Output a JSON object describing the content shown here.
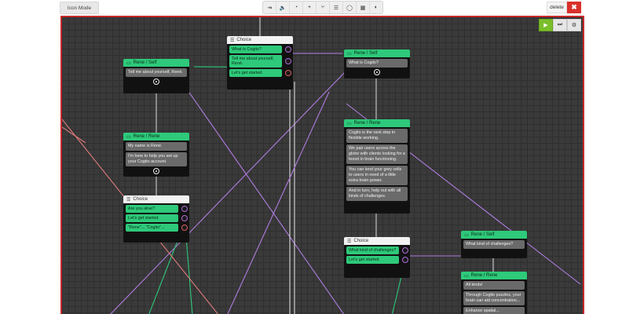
{
  "toolbar": {
    "mode_label": "Icon Mode",
    "tools": [
      "sign-in-icon",
      "volume-icon",
      "clock-icon",
      "plus-icon",
      "branch-icon",
      "list-icon",
      "comment-icon",
      "calendar-icon",
      "palette-icon"
    ],
    "tool_glyphs": [
      "⇥",
      "🔈",
      "◔",
      "+",
      "⑂",
      "☰",
      "◯",
      "▦",
      "◐"
    ],
    "delete_label": "delete",
    "close_glyph": "✖"
  },
  "controls": {
    "play": "▶",
    "skip": "⏭",
    "settings": "⚙"
  },
  "nodes": {
    "n1": {
      "header": "Rene / Self",
      "bubbles": [
        "Tell me about yourself, René."
      ]
    },
    "n2": {
      "header": "Rene / Rene",
      "bubbles": [
        "My name is René.",
        "I'm here to help you set up your Cogito account."
      ]
    },
    "n3": {
      "header": "Choice",
      "options": [
        "Are you alive?",
        "Let's get started.",
        "\"Rene\"... \"Cogito\"..."
      ]
    },
    "n4": {
      "header": "Choice",
      "options": [
        "What is Cogito?",
        "Tell me about yourself, René.",
        "Let's get started."
      ]
    },
    "n5": {
      "header": "Rene / Self",
      "bubbles": [
        "What is Cogito?"
      ]
    },
    "n6": {
      "header": "Rene / Rene",
      "bubbles": [
        "Cogito is the next step in flexible working.",
        "We pair users across the globe with clients looking for a boost in brain functioning.",
        "You can lend your grey cells to users in need of a little extra brain power.",
        "And in turn, help out with all kinds of challenges."
      ]
    },
    "n7": {
      "header": "Choice",
      "options": [
        "What kind of challenges?",
        "Let's get started."
      ]
    },
    "n8": {
      "header": "Rene / Self",
      "bubbles": [
        "What kind of challenges?"
      ]
    },
    "n9": {
      "header": "Rene / Rene",
      "bubbles": [
        "All kinds!",
        "Through Cogito puzzles, your brain can aid concentration...",
        "Enhance spatial..."
      ]
    }
  },
  "colors": {
    "accent_green": "#2ec97a",
    "wire_purple": "#b07ce0",
    "border_red": "#c8282b"
  }
}
